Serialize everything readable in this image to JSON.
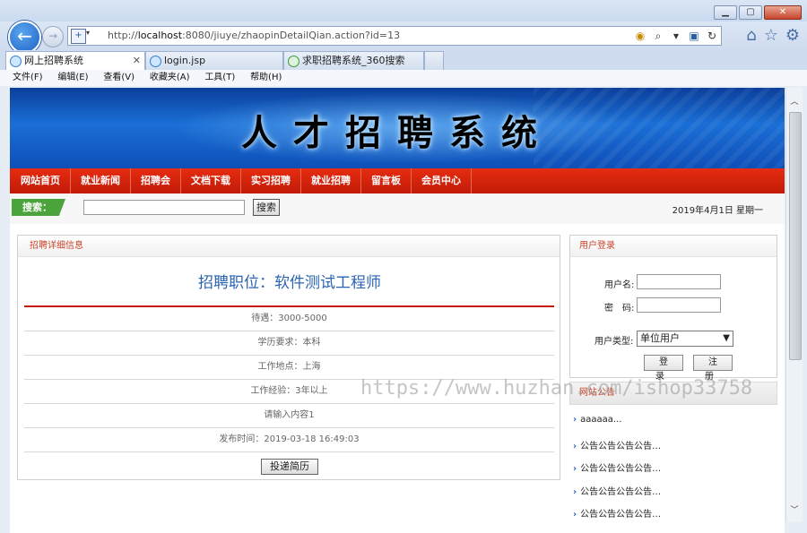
{
  "browser": {
    "address": {
      "prefix": "http://",
      "host": "localhost",
      "rest": ":8080/jiuye/zhaopinDetailQian.action?id=13"
    },
    "tabs": [
      {
        "label": "网上招聘系统",
        "active": true
      },
      {
        "label": "login.jsp",
        "active": false
      },
      {
        "label": "求职招聘系统_360搜索",
        "active": false
      }
    ],
    "menu": [
      "文件(F)",
      "编辑(E)",
      "查看(V)",
      "收藏夹(A)",
      "工具(T)",
      "帮助(H)"
    ]
  },
  "site": {
    "banner_title": "人才招聘系统",
    "nav": [
      "网站首页",
      "就业新闻",
      "招聘会",
      "文档下载",
      "实习招聘",
      "就业招聘",
      "留言板",
      "会员中心"
    ],
    "search": {
      "label": "搜索：",
      "button": "搜索",
      "value": ""
    },
    "date": "2019年4月1日  星期一"
  },
  "detail": {
    "panel_title": "招聘详细信息",
    "job_title": "招聘职位：软件测试工程师",
    "rows": [
      "待遇：3000-5000",
      "学历要求：本科",
      "工作地点：上海",
      "工作经验：3年以上",
      "请输入内容1",
      "发布时间：2019-03-18 16:49:03"
    ],
    "apply_button": "投递简历"
  },
  "login": {
    "panel_title": "用户登录",
    "username_label": "用户名:",
    "password_label": "密　码:",
    "type_label": "用户类型:",
    "type_selected": "单位用户",
    "login_button": "登录",
    "register_button": "注册"
  },
  "notice": {
    "panel_title": "网站公告",
    "items": [
      "aaaaaa...",
      "公告公告公告公告…",
      "公告公告公告公告…",
      "公告公告公告公告…",
      "公告公告公告公告…"
    ]
  },
  "watermark": "https://www.huzhan.com/ishop33758"
}
